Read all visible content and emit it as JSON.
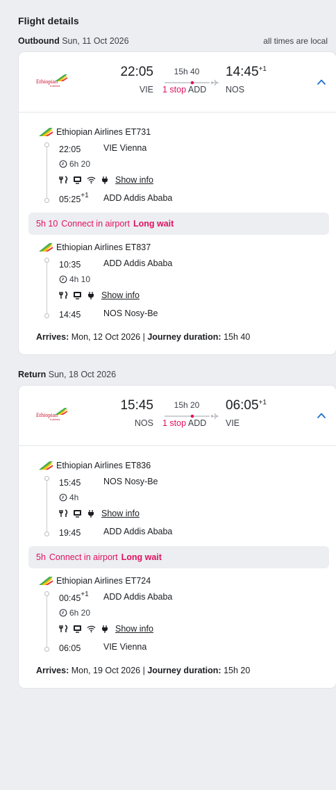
{
  "page": {
    "title": "Flight details",
    "times_note": "all times are local"
  },
  "outbound": {
    "label": "Outbound",
    "date": "Sun, 11 Oct 2026",
    "summary": {
      "airline_logo": "Ethiopian",
      "airline_logo_sub": "ቒ airlines",
      "dep_time": "22:05",
      "dep_code": "VIE",
      "duration": "15h 40",
      "stops": "1 stop",
      "stop_code": "ADD",
      "arr_time": "14:45",
      "arr_plus": "+1",
      "arr_code": "NOS"
    },
    "segments": [
      {
        "airline": "Ethiopian Airlines ET731",
        "dep_time": "22:05",
        "dep_plus": "",
        "dep_place": "VIE Vienna",
        "duration": "6h 20",
        "wifi": true,
        "show_info": "Show info",
        "arr_time": "05:25",
        "arr_plus": "+1",
        "arr_place": "ADD Addis Ababa"
      },
      {
        "airline": "Ethiopian Airlines ET837",
        "dep_time": "10:35",
        "dep_plus": "",
        "dep_place": "ADD Addis Ababa",
        "duration": "4h 10",
        "wifi": false,
        "show_info": "Show info",
        "arr_time": "14:45",
        "arr_plus": "",
        "arr_place": "NOS Nosy-Be"
      }
    ],
    "layover": {
      "duration": "5h 10",
      "text": "Connect in airport",
      "badge": "Long wait"
    },
    "arrives_label": "Arrives:",
    "arrives_date": "Mon, 12 Oct 2026",
    "separator": "|",
    "journey_label": "Journey duration:",
    "journey_duration": "15h 40"
  },
  "return": {
    "label": "Return",
    "date": "Sun, 18 Oct 2026",
    "summary": {
      "airline_logo": "Ethiopian",
      "airline_logo_sub": "ቒ airlines",
      "dep_time": "15:45",
      "dep_code": "NOS",
      "duration": "15h 20",
      "stops": "1 stop",
      "stop_code": "ADD",
      "arr_time": "06:05",
      "arr_plus": "+1",
      "arr_code": "VIE"
    },
    "segments": [
      {
        "airline": "Ethiopian Airlines ET836",
        "dep_time": "15:45",
        "dep_plus": "",
        "dep_place": "NOS Nosy-Be",
        "duration": "4h",
        "wifi": false,
        "show_info": "Show info",
        "arr_time": "19:45",
        "arr_plus": "",
        "arr_place": "ADD Addis Ababa"
      },
      {
        "airline": "Ethiopian Airlines ET724",
        "dep_time": "00:45",
        "dep_plus": "+1",
        "dep_place": "ADD Addis Ababa",
        "duration": "6h 20",
        "wifi": true,
        "show_info": "Show info",
        "arr_time": "06:05",
        "arr_plus": "",
        "arr_place": "VIE Vienna"
      }
    ],
    "layover": {
      "duration": "5h",
      "text": "Connect in airport",
      "badge": "Long wait"
    },
    "arrives_label": "Arrives:",
    "arrives_date": "Mon, 19 Oct 2026",
    "separator": "|",
    "journey_label": "Journey duration:",
    "journey_duration": "15h 20"
  },
  "icons": [
    "ethiopian-logo-icon",
    "plane-icon",
    "chevron-up-icon",
    "clock-icon",
    "meal-icon",
    "entertainment-icon",
    "wifi-icon",
    "power-icon",
    "airline-tail-icon"
  ],
  "colors": {
    "accent": "#e0115f",
    "link_blue": "#1f6fd1",
    "background": "#eceef1",
    "card": "#ffffff"
  }
}
